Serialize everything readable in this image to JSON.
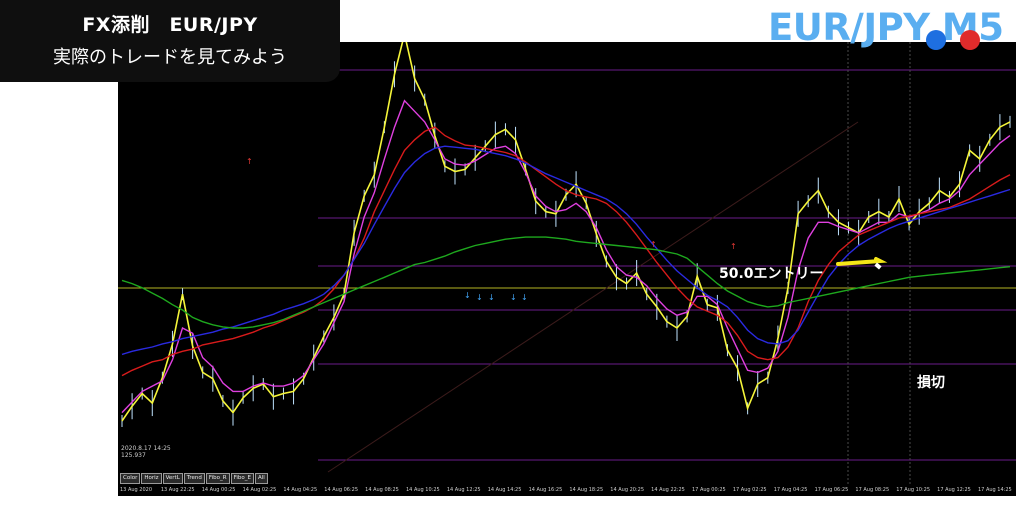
{
  "overlay": {
    "title_line1": "FX添削　EUR/JPY",
    "title_line2": "実際のトレードを見てみよう"
  },
  "symbol_title": "EUR/JPY M5",
  "chart_data": {
    "type": "line",
    "title": "EUR/JPY M5",
    "series": [
      {
        "values": [
          52,
          66,
          78,
          69,
          93,
          125,
          172,
          123,
          98,
          92,
          71,
          60,
          74,
          83,
          87,
          75,
          78,
          80,
          92,
          112,
          132,
          150,
          172,
          230,
          265,
          285,
          330,
          380,
          418,
          376,
          356,
          322,
          293,
          288,
          290,
          301,
          312,
          323,
          328,
          318,
          290,
          260,
          250,
          248,
          266,
          276,
          258,
          229,
          203,
          188,
          182,
          192,
          172,
          160,
          146,
          140,
          151,
          189,
          162,
          159,
          119,
          102,
          64,
          87,
          93,
          130,
          178,
          248,
          260,
          270,
          250,
          240,
          235,
          230,
          245,
          250,
          245,
          262,
          238,
          250,
          258,
          270,
          264,
          276,
          308,
          300,
          318,
          330,
          335
        ]
      },
      {
        "values": [
          60,
          70,
          80,
          85,
          90,
          110,
          140,
          135,
          112,
          103,
          88,
          80,
          80,
          85,
          88,
          85,
          85,
          88,
          95,
          110,
          125,
          145,
          165,
          210,
          245,
          268,
          300,
          330,
          355,
          345,
          335,
          318,
          300,
          295,
          294,
          298,
          304,
          310,
          312,
          305,
          287,
          265,
          255,
          250,
          252,
          258,
          250,
          235,
          214,
          198,
          190,
          188,
          180,
          168,
          158,
          152,
          155,
          170,
          170,
          162,
          140,
          120,
          100,
          98,
          102,
          118,
          150,
          195,
          225,
          240,
          240,
          236,
          233,
          230,
          235,
          240,
          240,
          248,
          245,
          248,
          252,
          258,
          262,
          270,
          285,
          295,
          305,
          315,
          322
        ]
      },
      {
        "values": [
          95,
          100,
          104,
          108,
          110,
          115,
          118,
          120,
          124,
          126,
          128,
          130,
          133,
          136,
          140,
          143,
          147,
          151,
          155,
          160,
          167,
          177,
          190,
          205,
          225,
          250,
          270,
          290,
          308,
          318,
          326,
          330,
          322,
          317,
          313,
          312,
          310,
          308,
          306,
          303,
          297,
          290,
          283,
          276,
          270,
          266,
          264,
          262,
          258,
          250,
          240,
          228,
          215,
          202,
          190,
          178,
          168,
          160,
          156,
          152,
          145,
          133,
          118,
          112,
          110,
          112,
          122,
          140,
          165,
          185,
          200,
          212,
          220,
          228,
          232,
          236,
          240,
          244,
          246,
          248,
          250,
          252,
          254,
          258,
          262,
          268,
          274,
          280,
          285
        ]
      },
      {
        "values": [
          115,
          118,
          120,
          122,
          125,
          127,
          130,
          132,
          134,
          136,
          139,
          141,
          144,
          147,
          150,
          153,
          157,
          160,
          163,
          167,
          172,
          180,
          190,
          205,
          220,
          238,
          255,
          272,
          287,
          297,
          305,
          310,
          312,
          311,
          310,
          309,
          307,
          305,
          303,
          300,
          296,
          291,
          286,
          282,
          278,
          274,
          270,
          266,
          262,
          256,
          248,
          238,
          226,
          215,
          204,
          194,
          186,
          178,
          171,
          166,
          160,
          150,
          138,
          130,
          126,
          125,
          128,
          138,
          155,
          172,
          188,
          200,
          210,
          218,
          224,
          229,
          234,
          238,
          241,
          244,
          247,
          250,
          253,
          256,
          259,
          262,
          265,
          268,
          271
        ]
      },
      {
        "values": [
          185,
          182,
          178,
          173,
          168,
          162,
          157,
          150,
          146,
          143,
          141,
          140,
          140,
          141,
          143,
          145,
          148,
          152,
          156,
          160,
          164,
          168,
          172,
          176,
          180,
          184,
          188,
          192,
          196,
          200,
          202,
          205,
          208,
          212,
          215,
          218,
          220,
          222,
          224,
          225,
          226,
          226,
          226,
          225,
          224,
          222,
          221,
          220,
          219,
          218,
          217,
          216,
          215,
          214,
          212,
          210,
          206,
          198,
          190,
          182,
          175,
          170,
          165,
          162,
          160,
          161,
          164,
          166,
          168,
          170,
          172,
          174,
          176,
          178,
          180,
          182,
          184,
          186,
          188,
          189,
          190,
          191,
          192,
          193,
          194,
          195,
          196,
          197,
          198
        ]
      }
    ],
    "y_markers": [],
    "time_labels": [
      "13 Aug 2020",
      "13 Aug 22:25",
      "14 Aug 00:25",
      "14 Aug 02:25",
      "14 Aug 04:25",
      "14 Aug 06:25",
      "14 Aug 08:25",
      "14 Aug 10:25",
      "14 Aug 12:25",
      "14 Aug 14:25",
      "14 Aug 16:25",
      "14 Aug 18:25",
      "14 Aug 20:25",
      "14 Aug 22:25",
      "17 Aug 00:25",
      "17 Aug 02:25",
      "17 Aug 04:25",
      "17 Aug 06:25",
      "17 Aug 08:25",
      "17 Aug 10:25",
      "17 Aug 12:25",
      "17 Aug 14:25"
    ]
  },
  "chart_info": {
    "timestamp": "2020.8.17 14:25",
    "price": "125.937"
  },
  "toolbar_buttons": [
    "Color",
    "Horiz",
    "VertL",
    "Trend",
    "Fibo_R",
    "Fibo_E",
    "All"
  ],
  "annotations": {
    "entry": "50.0エントリー",
    "stoploss": "損切"
  },
  "colors": {
    "accent_title": "#5aaef0",
    "series": [
      "#f5f53a",
      "#e040e0",
      "#d81b1b",
      "#2a2ae0",
      "#1ea81e"
    ],
    "guide_line": "#8a2be2",
    "yellow_line": "#cccc22",
    "highlight": "#f5e617"
  }
}
